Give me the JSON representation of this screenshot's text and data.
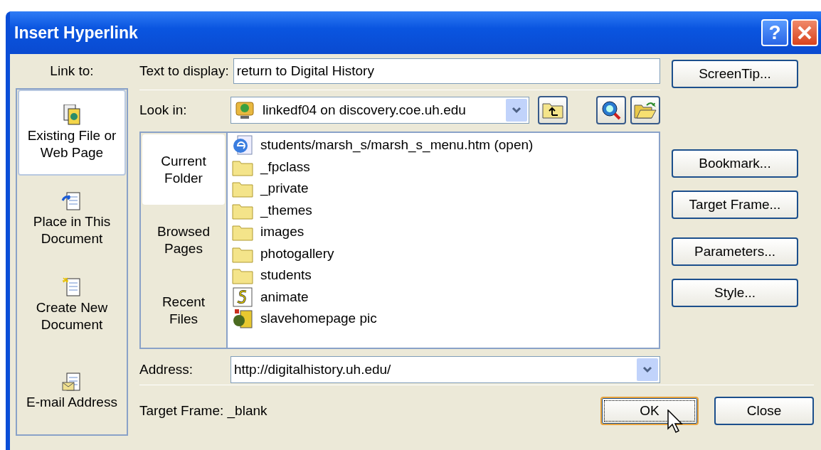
{
  "window": {
    "title": "Insert Hyperlink",
    "help_button": "?"
  },
  "link_to": {
    "label": "Link to:",
    "items": [
      {
        "label": "Existing File or Web Page",
        "kind": "file",
        "selected": true
      },
      {
        "label": "Place in This Document",
        "kind": "place",
        "selected": false
      },
      {
        "label": "Create New Document",
        "kind": "new",
        "selected": false
      },
      {
        "label": "E-mail Address",
        "kind": "email",
        "selected": false
      }
    ]
  },
  "text_to_display": {
    "label": "Text to display:",
    "value": "return to Digital History"
  },
  "screentip_button": "ScreenTip...",
  "look_in": {
    "label": "Look in:",
    "value": "linkedf04 on discovery.coe.uh.edu"
  },
  "browse_tabs": [
    {
      "label": "Current Folder",
      "selected": true
    },
    {
      "label": "Browsed Pages",
      "selected": false
    },
    {
      "label": "Recent Files",
      "selected": false
    }
  ],
  "files": [
    {
      "name": "students/marsh_s/marsh_s_menu.htm (open)",
      "kind": "web"
    },
    {
      "name": "_fpclass",
      "kind": "folder"
    },
    {
      "name": "_private",
      "kind": "folder"
    },
    {
      "name": "_themes",
      "kind": "folder"
    },
    {
      "name": "images",
      "kind": "folder"
    },
    {
      "name": "photogallery",
      "kind": "folder"
    },
    {
      "name": "students",
      "kind": "folder"
    },
    {
      "name": "animate",
      "kind": "script"
    },
    {
      "name": "slavehomepage pic",
      "kind": "image"
    }
  ],
  "address": {
    "label": "Address:",
    "value": "http://digitalhistory.uh.edu/"
  },
  "side_buttons": [
    "Bookmark...",
    "Target Frame...",
    "Parameters...",
    "Style..."
  ],
  "target_frame": "Target Frame: _blank",
  "ok_button": {
    "label": "OK",
    "default": true
  },
  "close_button": "Close"
}
